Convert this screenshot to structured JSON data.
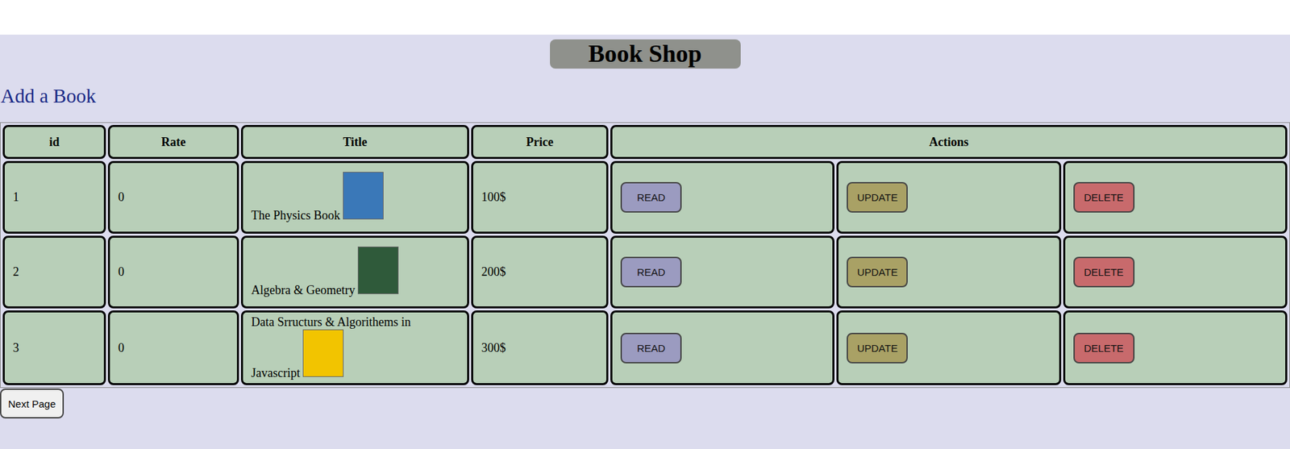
{
  "window": {
    "title": "Book Shop"
  },
  "add_link": "Add a Book",
  "table": {
    "columns": [
      "id",
      "Rate",
      "Title",
      "Price",
      "Actions"
    ],
    "rows": [
      {
        "id": "1",
        "rate": "0",
        "title": "The Physics Book",
        "price": "100$",
        "color": "#3a78b8"
      },
      {
        "id": "2",
        "rate": "0",
        "title": "Algebra & Geometry",
        "price": "200$",
        "color": "#2f5a3a"
      },
      {
        "id": "3",
        "rate": "0",
        "title": "Data Srructurs & Algorithems in Javascript",
        "price": "300$",
        "color": "#f2c400"
      }
    ],
    "actions": [
      {
        "label": "READ",
        "color": "#9b9bc0"
      },
      {
        "label": "UPDATE",
        "color": "#a9a165"
      },
      {
        "label": "DELETE",
        "color": "#c86a6c"
      }
    ]
  },
  "next_button": "Next Page"
}
